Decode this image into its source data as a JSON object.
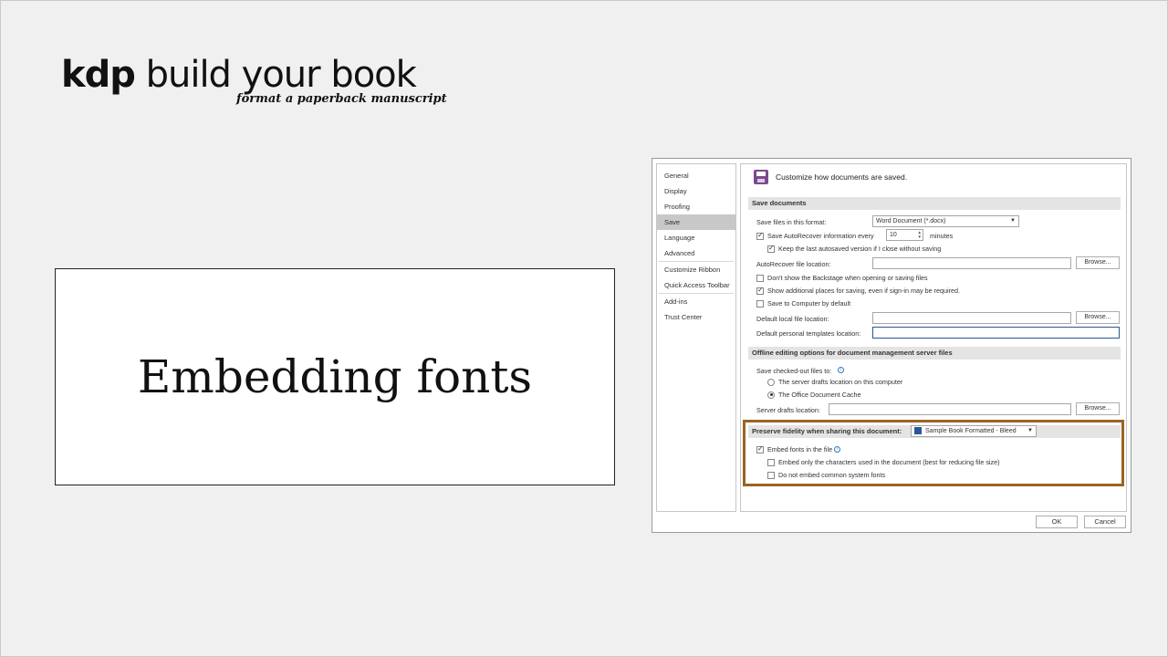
{
  "brand": {
    "kdp": "kdp",
    "rest": " build your book",
    "subtitle": "format a paperback manuscript"
  },
  "slide": {
    "title": "Embedding fonts"
  },
  "dialog": {
    "nav": [
      "General",
      "Display",
      "Proofing",
      "Save",
      "Language",
      "Advanced",
      "Customize Ribbon",
      "Quick Access Toolbar",
      "Add-ins",
      "Trust Center"
    ],
    "selected_nav": "Save",
    "header": "Customize how documents are saved.",
    "save_section": {
      "title": "Save documents",
      "format_label": "Save files in this format:",
      "format_value": "Word Document (*.docx)",
      "autorecover_label": "Save AutoRecover information every",
      "autorecover_value": "10",
      "autorecover_unit": "minutes",
      "keep_label": "Keep the last autosaved version if I close without saving",
      "autorecover_loc_label": "AutoRecover file location:",
      "browse": "Browse...",
      "dont_show_label": "Don't show the Backstage when opening or saving files",
      "show_places_label": "Show additional places for saving, even if sign-in may be required.",
      "save_computer_label": "Save to Computer by default",
      "default_local_label": "Default local file location:",
      "default_templates_label": "Default personal templates location:"
    },
    "offline_section": {
      "title": "Offline editing options for document management server files",
      "checked_out_label": "Save checked-out files to:",
      "radio_server": "The server drafts location on this computer",
      "radio_cache": "The Office Document Cache",
      "server_drafts_label": "Server drafts location:",
      "browse": "Browse..."
    },
    "fidelity_section": {
      "title": "Preserve fidelity when sharing this document:",
      "doc_value": "Sample Book Formatted - Bleed",
      "embed_label": "Embed fonts in the file",
      "embed_only_label": "Embed only the characters used in the document (best for reducing file size)",
      "no_common_label": "Do not embed common system fonts"
    },
    "ok": "OK",
    "cancel": "Cancel"
  },
  "colors": {
    "highlight": "#9a6323",
    "selected_nav": "#c8c8c8",
    "save_icon": "#7a4b8c"
  }
}
